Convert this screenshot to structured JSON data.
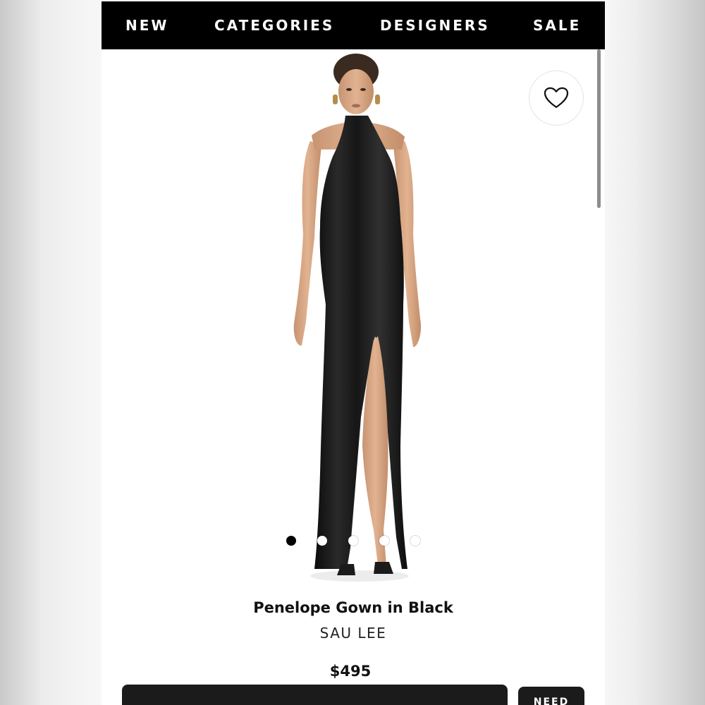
{
  "nav": {
    "items": [
      {
        "label": "NEW"
      },
      {
        "label": "CATEGORIES"
      },
      {
        "label": "DESIGNERS"
      },
      {
        "label": "SALE"
      }
    ]
  },
  "product": {
    "name": "Penelope Gown in Black",
    "brand": "SAU LEE",
    "price": "$495",
    "image_count": 5,
    "active_image_index": 0
  },
  "actions": {
    "wishlist_icon": "heart-outline-icon",
    "need_help_label": "NEED"
  },
  "colors": {
    "nav_bg": "#000000",
    "nav_text": "#ffffff",
    "button_bg": "#1b1b1b",
    "dress": "#141414"
  }
}
